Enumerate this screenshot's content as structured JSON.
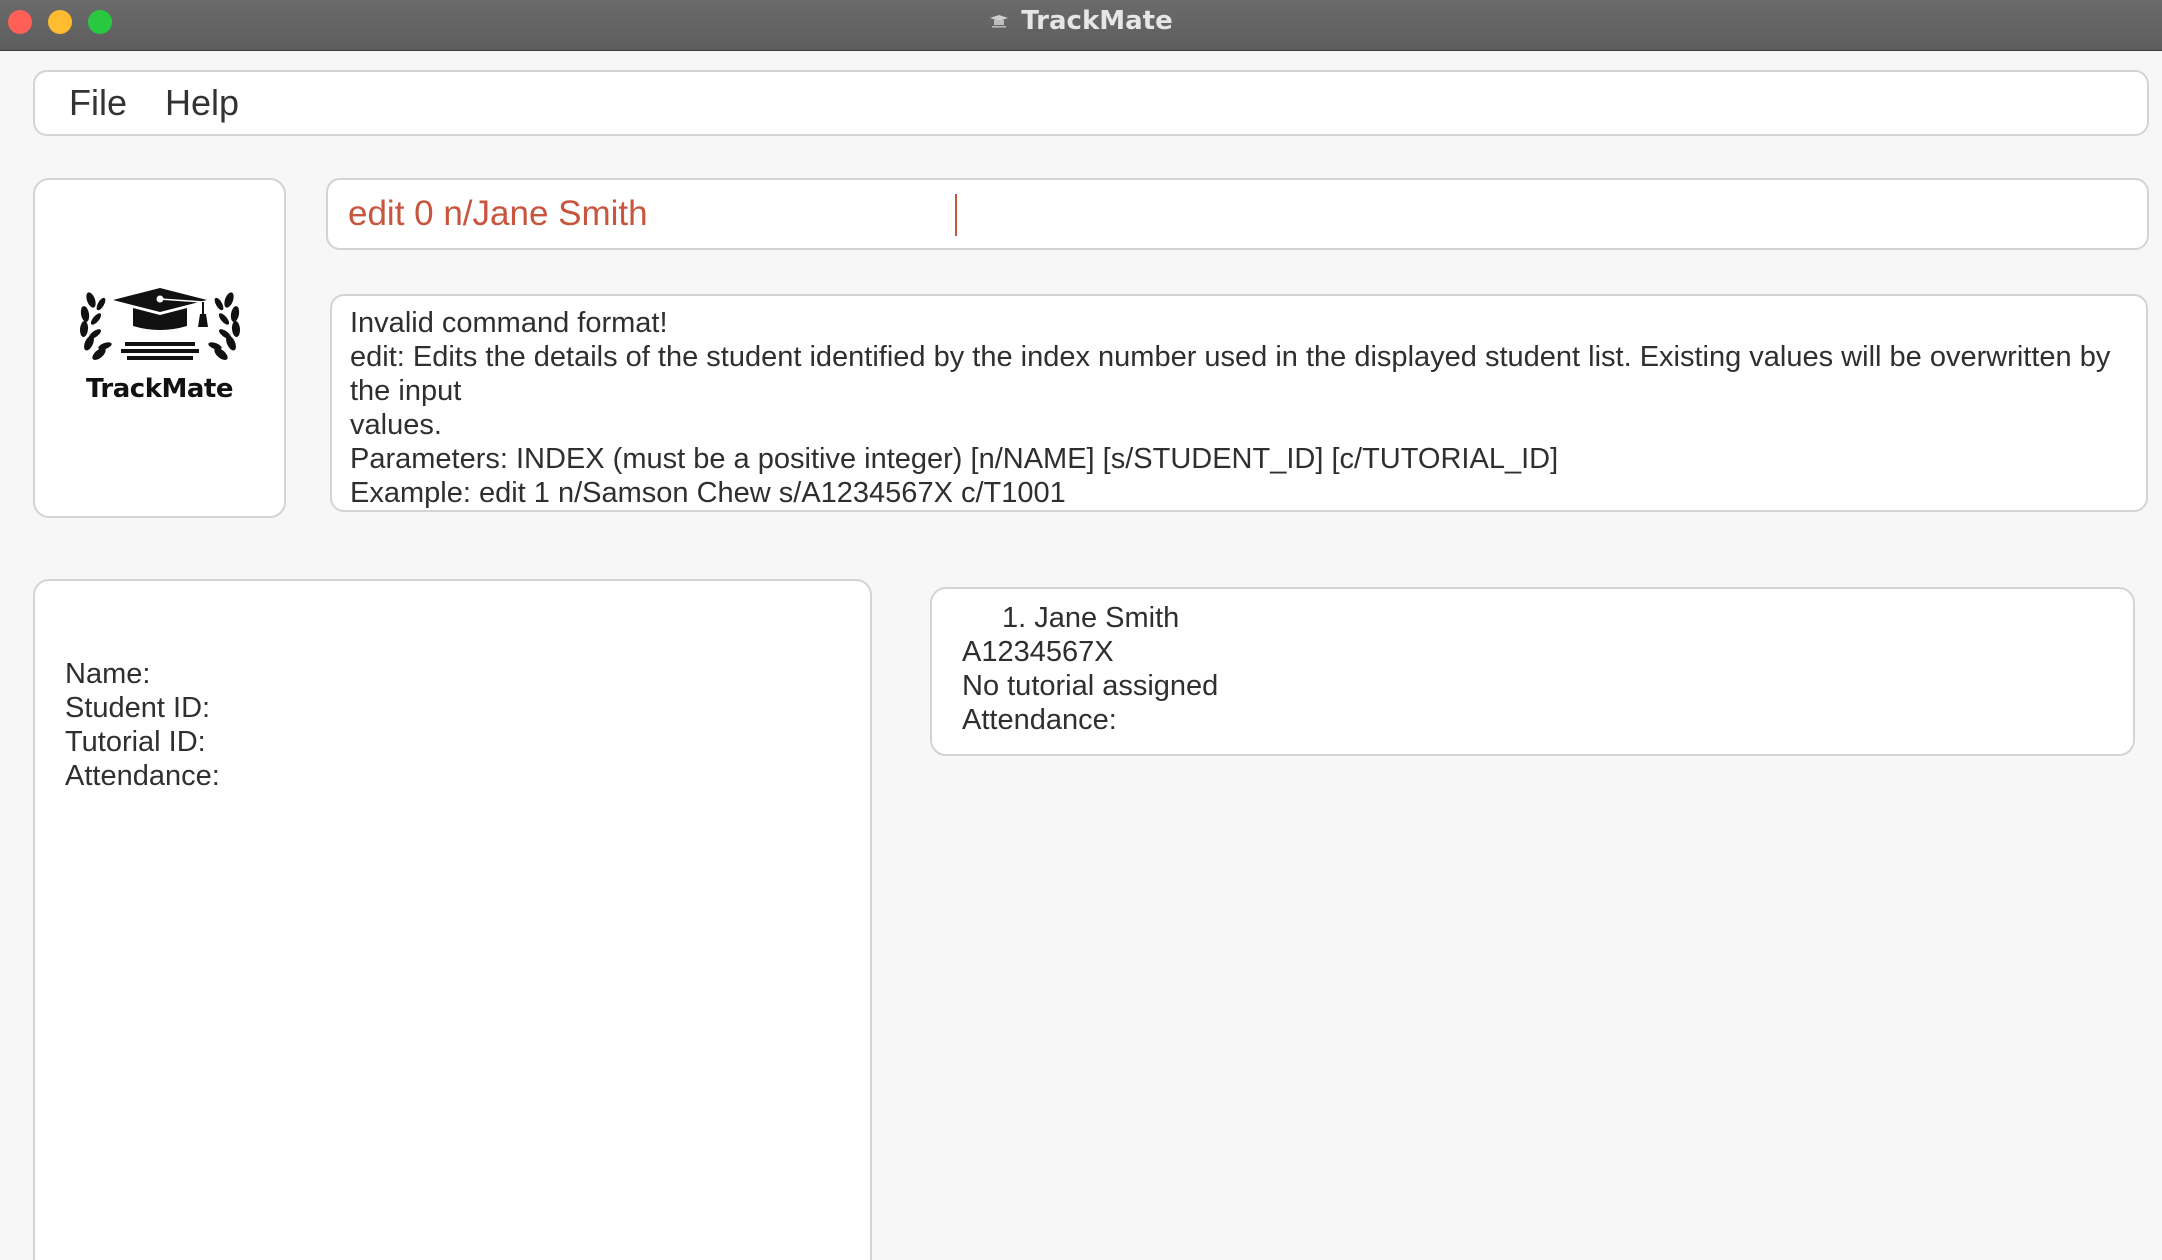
{
  "window": {
    "title": "TrackMate",
    "traffic_lights": {
      "close": "#ff5f57",
      "minimize": "#febc2e",
      "maximize": "#28c840"
    }
  },
  "menu": {
    "items": [
      {
        "label": "File"
      },
      {
        "label": "Help"
      }
    ]
  },
  "logo": {
    "icon": "graduation-cap-laurel-icon",
    "text": "TrackMate"
  },
  "command": {
    "value": "edit 0 n/Jane Smith",
    "text_color": "#c8553d"
  },
  "result": {
    "lines": [
      "Invalid command format!",
      "edit: Edits the details of the student identified by the index number used in the displayed student list. Existing values will be overwritten by the input",
      "values.",
      "Parameters: INDEX (must be a positive integer) [n/NAME] [s/STUDENT_ID] [c/TUTORIAL_ID]",
      "Example: edit 1 n/Samson Chew s/A1234567X c/T1001"
    ]
  },
  "detail": {
    "name_label": "Name:",
    "student_id_label": "Student ID:",
    "tutorial_id_label": "Tutorial ID:",
    "attendance_label": "Attendance:"
  },
  "students": [
    {
      "name_line": "1. Jane Smith",
      "student_id": "A1234567X",
      "tutorial": "No tutorial assigned",
      "attendance_label": "Attendance:"
    }
  ]
}
